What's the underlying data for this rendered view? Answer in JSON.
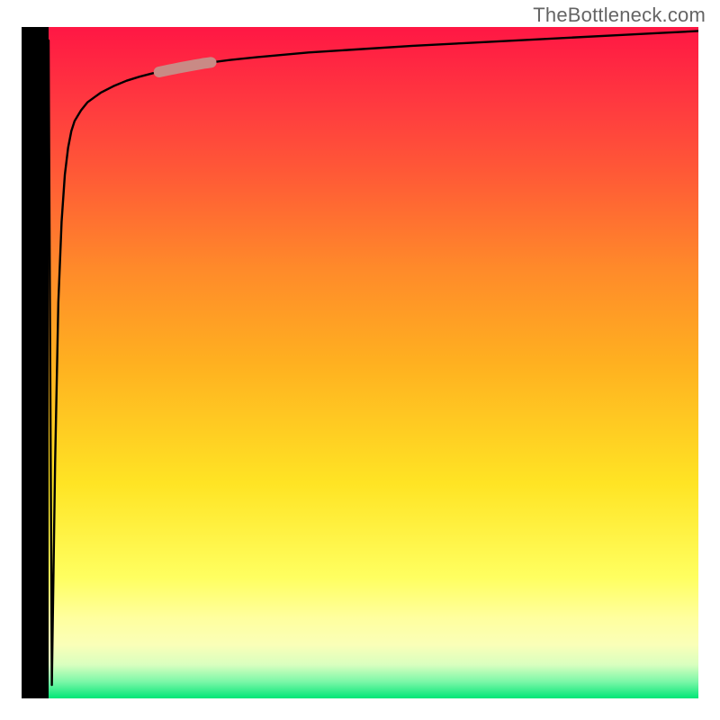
{
  "attribution": "TheBottleneck.com",
  "chart_data": {
    "type": "line",
    "x": [
      0.0,
      0.005,
      0.01,
      0.015,
      0.02,
      0.025,
      0.03,
      0.035,
      0.04,
      0.05,
      0.06,
      0.07,
      0.08,
      0.1,
      0.12,
      0.14,
      0.16,
      0.18,
      0.2,
      0.24,
      0.28,
      0.32,
      0.4,
      0.48,
      0.56,
      0.64,
      0.72,
      0.8,
      0.88,
      0.94,
      1.0
    ],
    "values": [
      0.98,
      0.02,
      0.35,
      0.59,
      0.71,
      0.78,
      0.82,
      0.845,
      0.86,
      0.876,
      0.888,
      0.895,
      0.902,
      0.912,
      0.92,
      0.926,
      0.931,
      0.935,
      0.939,
      0.946,
      0.951,
      0.955,
      0.962,
      0.967,
      0.972,
      0.976,
      0.98,
      0.984,
      0.988,
      0.991,
      0.994
    ],
    "xlim": [
      0,
      1
    ],
    "ylim": [
      0,
      1
    ],
    "xlabel": "",
    "ylabel": "",
    "title": "",
    "highlight_segment": {
      "x_start": 0.17,
      "x_end": 0.25
    },
    "colors": {
      "curve": "#000000",
      "highlight": "#c98a85",
      "edge_bars": "#000000",
      "gradient_top": "#ff1744",
      "gradient_mid": "#ffe424",
      "gradient_bottom": "#00e676"
    }
  }
}
